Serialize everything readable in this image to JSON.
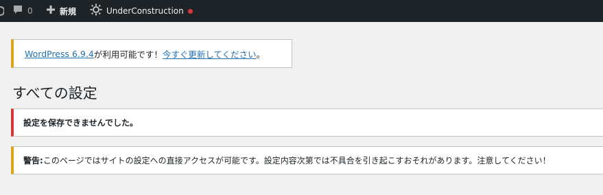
{
  "adminbar": {
    "comments_count": "0",
    "new_label": "新規",
    "site_name": "UnderConstruction"
  },
  "update_notice": {
    "link_version": "WordPress 6.9.4",
    "middle": " が利用可能です！",
    "link_update": "今すぐ更新してください",
    "end": "。"
  },
  "page": {
    "title": "すべての設定"
  },
  "error_notice": {
    "text": "設定を保存できませんでした。"
  },
  "warning_notice": {
    "label": "警告:",
    "text": " このページではサイトの設定への直接アクセスが可能です。設定内容次第では不具合を引き起こすおそれがあります。注意してください！"
  },
  "colors": {
    "adminbar_bg": "#1d2327",
    "link": "#2271b1",
    "error": "#d63638",
    "warning": "#dba617",
    "status_dot": "#d63638"
  },
  "icons": {
    "edge": "wp-logo-icon",
    "comments": "comment-bubble-icon",
    "new": "plus-icon",
    "site": "gear-icon"
  }
}
